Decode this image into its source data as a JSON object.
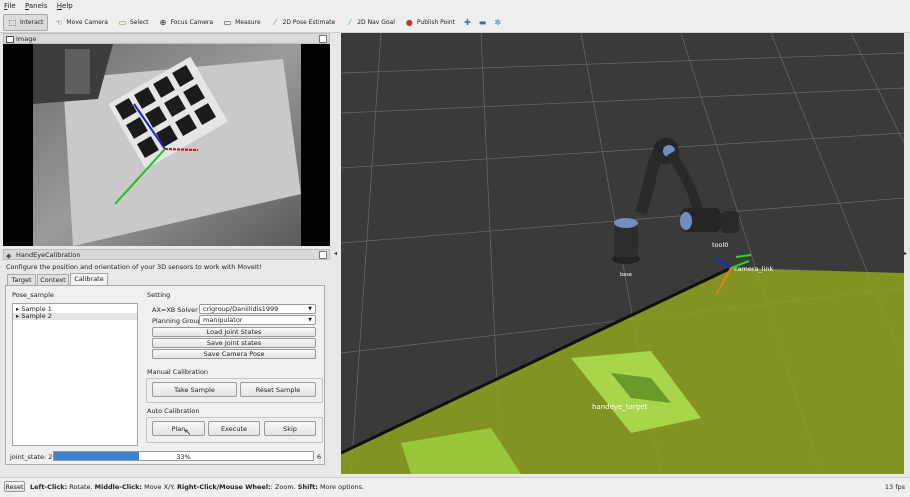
{
  "menu": [
    "File",
    "Panels",
    "Help"
  ],
  "toolbar": {
    "tools": [
      {
        "label": "Interact",
        "icon": "interact-icon"
      },
      {
        "label": "Move Camera",
        "icon": "move-camera-icon"
      },
      {
        "label": "Select",
        "icon": "select-icon"
      },
      {
        "label": "Focus Camera",
        "icon": "focus-camera-icon"
      },
      {
        "label": "Measure",
        "icon": "measure-icon"
      },
      {
        "label": "2D Pose Estimate",
        "icon": "pose-estimate-icon"
      },
      {
        "label": "2D Nav Goal",
        "icon": "nav-goal-icon"
      },
      {
        "label": "Publish Point",
        "icon": "publish-point-icon"
      }
    ],
    "active": "Interact"
  },
  "image_panel": {
    "title": "Image"
  },
  "calib_panel": {
    "title": "HandEyeCalibration",
    "description": "Configure the position and orientation of your 3D sensors to work with MoveIt!",
    "tabs": [
      "Target",
      "Context",
      "Calibrate"
    ],
    "active_tab": "Calibrate",
    "pose_sample": {
      "label": "Pose_sample",
      "items": [
        "Sample 1",
        "Sample 2"
      ]
    },
    "setting": {
      "label": "Setting",
      "solver_label": "AX=XB Solver",
      "solver_value": "crigroup/Daniilidis1999",
      "planning_group_label": "Planning Group",
      "planning_group_value": "manipulator",
      "load_joint_states": "Load Joint States",
      "save_joint_states": "Save Joint states",
      "save_camera_pose": "Save Camera Pose"
    },
    "manual": {
      "label": "Manual Calibration",
      "take_sample": "Take Sample",
      "reset_sample": "Reset Sample"
    },
    "auto": {
      "label": "Auto Calibration",
      "plan": "Plan",
      "execute": "Execute",
      "skip": "Skip"
    },
    "progress": {
      "label": "joint_state: 2",
      "percent_text": "33%",
      "max": "6",
      "fraction": 0.33
    }
  },
  "viewport": {
    "labels": {
      "tool0": "tool0",
      "camera_link": "camera_link",
      "base": "base",
      "handeye_target": "handeye_target"
    }
  },
  "status": {
    "reset": "Reset",
    "hint_left_bold": "Left-Click:",
    "hint_left": " Rotate. ",
    "hint_middle_bold": "Middle-Click:",
    "hint_middle": " Move X/Y. ",
    "hint_right_bold": "Right-Click/Mouse Wheel:",
    "hint_right": ": Zoom. ",
    "hint_shift_bold": "Shift:",
    "hint_shift": " More options.",
    "fps": "13 fps"
  },
  "colors": {
    "progress": "#3a86d1",
    "ground_fov": "#8fa321",
    "viewport_bg": "#3a3a3a"
  }
}
